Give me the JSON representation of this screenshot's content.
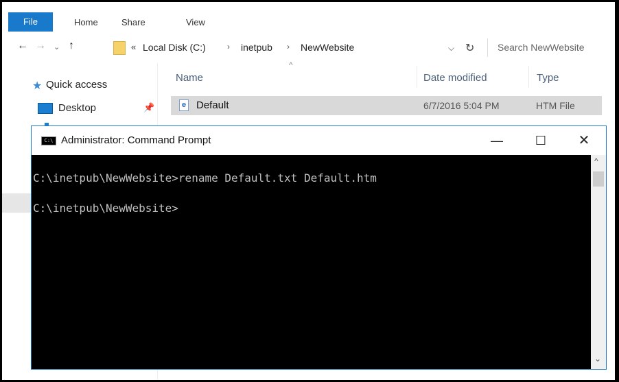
{
  "ribbon": {
    "tabs": [
      "File",
      "Home",
      "Share",
      "View"
    ]
  },
  "address": {
    "overflow": "«",
    "crumbs": [
      "Local Disk (C:)",
      "inetpub",
      "NewWebsite"
    ],
    "separator": "›",
    "search_placeholder": "Search NewWebsite"
  },
  "nav_pane": {
    "items": [
      "Quick access",
      "Desktop"
    ]
  },
  "columns": {
    "name": "Name",
    "date": "Date modified",
    "type": "Type"
  },
  "files": [
    {
      "name": "Default",
      "date": "6/7/2016 5:04 PM",
      "type": "HTM File"
    }
  ],
  "cmd": {
    "title": "Administrator: Command Prompt",
    "lines": [
      "C:\\inetpub\\NewWebsite>rename Default.txt Default.htm",
      "C:\\inetpub\\NewWebsite>"
    ]
  }
}
